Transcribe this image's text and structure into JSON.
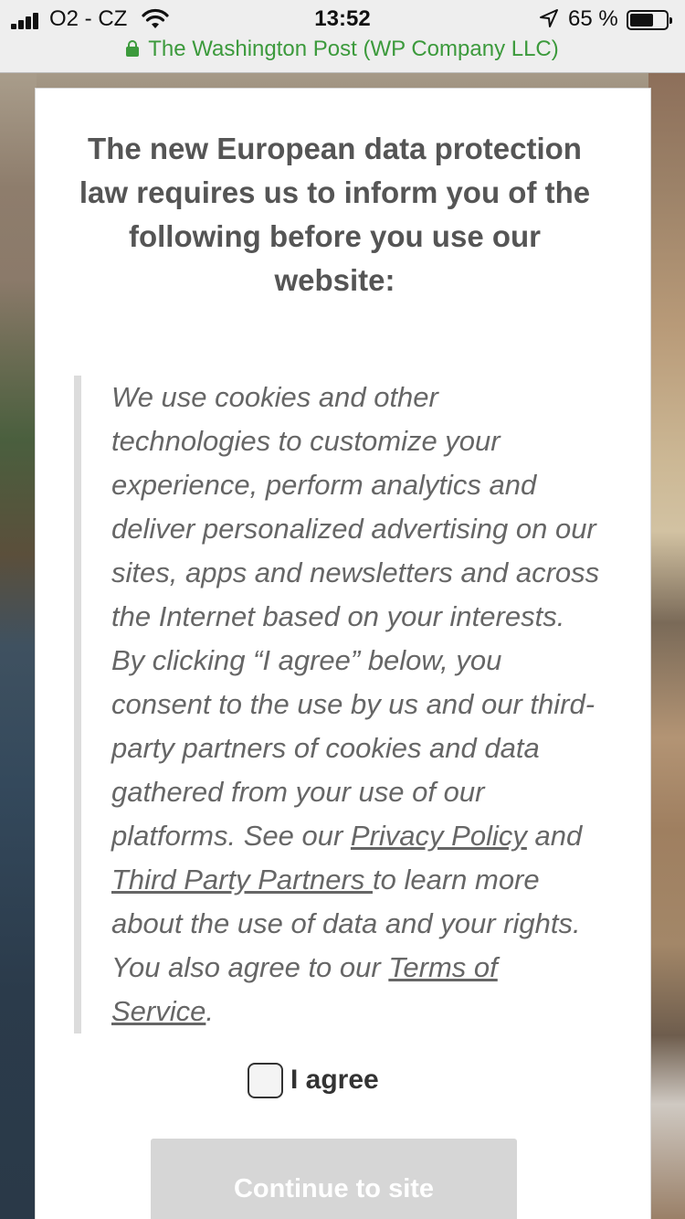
{
  "status_bar": {
    "carrier": "O2 - CZ",
    "time": "13:52",
    "battery_percent": "65 %",
    "battery_level": 0.65,
    "icons": [
      "signal-icon",
      "wifi-icon",
      "location-arrow-icon",
      "battery-icon"
    ]
  },
  "browser": {
    "site_identity": "The Washington Post (WP Company LLC)",
    "secure_color": "#3c9a3c"
  },
  "consent": {
    "heading": "The new European data protection law requires us to inform you of the following before you use our website:",
    "body_part1": "We use cookies and other technologies to customize your experience, perform analytics and deliver personalized advertising on our sites, apps and newsletters and across the Internet based on your interests. By clicking “I agree” below, you consent to the use by us and our third-party partners of cookies and data gathered from your use of our platforms. See our ",
    "privacy_link": "Privacy Policy",
    "body_part2": " and ",
    "partners_link": "Third Party Partners ",
    "body_part3": "to learn more about the use of data and your rights. You also agree to our ",
    "terms_link": "Terms of Service",
    "body_part4": ".",
    "agree_label": "I agree",
    "agree_checked": false,
    "continue_label": "Continue to site"
  }
}
